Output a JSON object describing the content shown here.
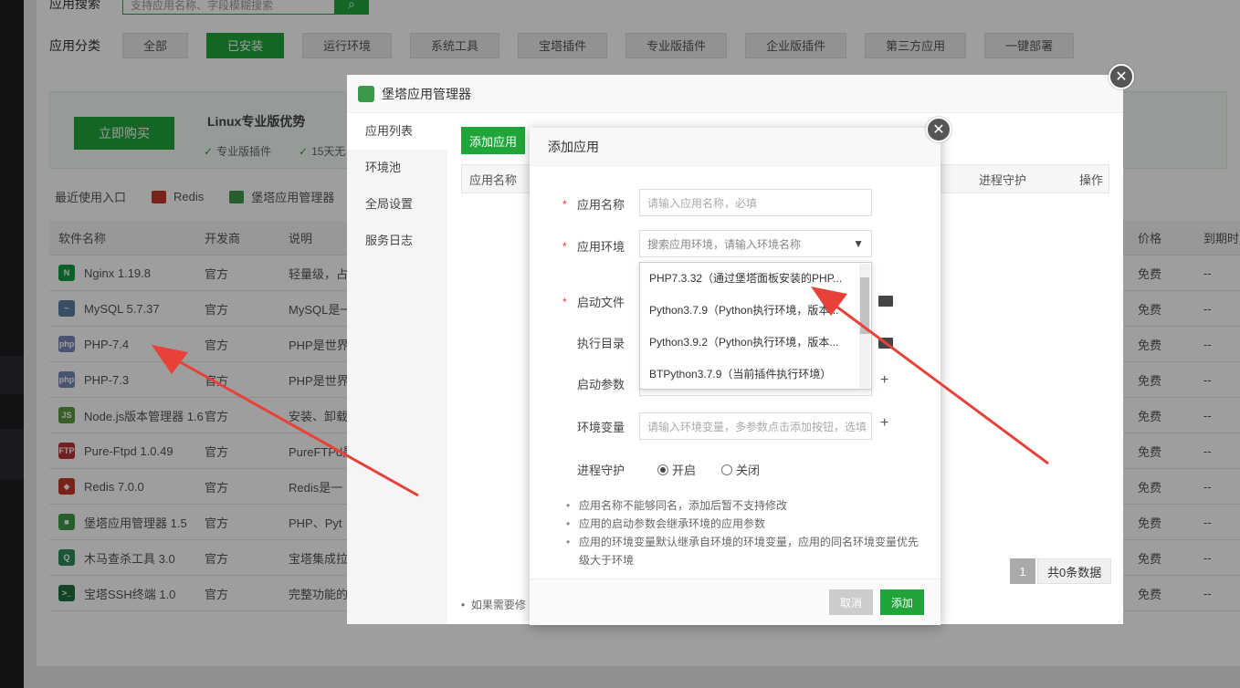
{
  "search": {
    "label": "应用搜索",
    "placeholder": "支持应用名称、字段模糊搜索"
  },
  "categories": {
    "label": "应用分类",
    "items": [
      "全部",
      "已安装",
      "运行环境",
      "系统工具",
      "宝塔插件",
      "专业版插件",
      "企业版插件",
      "第三方应用",
      "一键部署"
    ],
    "active": "已安装"
  },
  "promo": {
    "buy": "立即购买",
    "title": "Linux专业版优势",
    "feature1": "专业版插件",
    "feature2": "15天无"
  },
  "recent": {
    "label": "最近使用入口",
    "items": [
      "Redis",
      "堡塔应用管理器"
    ]
  },
  "soft_table": {
    "headers": [
      "软件名称",
      "开发商",
      "说明",
      "价格",
      "到期时间"
    ],
    "rows": [
      {
        "name": "Nginx 1.19.8",
        "dev": "官方",
        "desc": "轻量级，占",
        "price": "免费",
        "exp": "--",
        "icon": "nginx-icon",
        "color": "#119a45",
        "glyph": "N"
      },
      {
        "name": "MySQL 5.7.37",
        "dev": "官方",
        "desc": "MySQL是一",
        "price": "免费",
        "exp": "--",
        "icon": "mysql-icon",
        "color": "#5a7fa0",
        "glyph": "~"
      },
      {
        "name": "PHP-7.4",
        "dev": "官方",
        "desc": "PHP是世界",
        "price": "免费",
        "exp": "--",
        "icon": "php-icon",
        "color": "#7a86b8",
        "glyph": "php"
      },
      {
        "name": "PHP-7.3",
        "dev": "官方",
        "desc": "PHP是世界",
        "price": "免费",
        "exp": "--",
        "icon": "php-icon",
        "color": "#7a86b8",
        "glyph": "php"
      },
      {
        "name": "Node.js版本管理器 1.6",
        "dev": "官方",
        "desc": "安装、卸载",
        "price": "免费",
        "exp": "--",
        "icon": "nodejs-icon",
        "color": "#5b9a3c",
        "glyph": "JS"
      },
      {
        "name": "Pure-Ftpd 1.0.49",
        "dev": "官方",
        "desc": "PureFTPd是",
        "price": "免费",
        "exp": "--",
        "icon": "ftp-icon",
        "color": "#b33",
        "glyph": "FTP"
      },
      {
        "name": "Redis 7.0.0",
        "dev": "官方",
        "desc": "Redis是一",
        "price": "免费",
        "exp": "--",
        "icon": "redis-icon",
        "color": "#c0392b",
        "glyph": "◆"
      },
      {
        "name": "堡塔应用管理器 1.5",
        "dev": "官方",
        "desc": "PHP、Pyt",
        "price": "免费",
        "exp": "--",
        "icon": "app-manager-icon",
        "color": "#3a9a4a",
        "glyph": "■"
      },
      {
        "name": "木马查杀工具 3.0",
        "dev": "官方",
        "desc": "宝塔集成拉",
        "price": "免费",
        "exp": "--",
        "icon": "trojan-scan-icon",
        "color": "#2e8b57",
        "glyph": "Q"
      },
      {
        "name": "宝塔SSH终端 1.0",
        "dev": "官方",
        "desc": "完整功能的",
        "price": "免费",
        "exp": "--",
        "icon": "ssh-terminal-icon",
        "color": "#1f6f3a",
        "glyph": ">_"
      }
    ]
  },
  "manager": {
    "title": "堡塔应用管理器",
    "menu": [
      "应用列表",
      "环境池",
      "全局设置",
      "服务日志"
    ],
    "add_button": "添加应用",
    "columns": [
      "应用名称",
      "进程守护",
      "操作"
    ],
    "page": "1",
    "total": "共0条数据",
    "note": "如果需要修"
  },
  "dialog": {
    "title": "添加应用",
    "name_label": "应用名称",
    "name_placeholder": "请输入应用名称，必填",
    "env_label": "应用环境",
    "env_placeholder": "搜索应用环境，请输入环境名称",
    "env_options": [
      "PHP7.3.32（通过堡塔面板安装的PHP...",
      "Python3.7.9（Python执行环境，版本...",
      "Python3.9.2（Python执行环境，版本...",
      "BTPython3.7.9（当前插件执行环境）"
    ],
    "start_file_label": "启动文件",
    "exec_dir_label": "执行目录",
    "start_args_label": "启动参数",
    "env_var_label": "环境变量",
    "env_var_placeholder": "请输入环境变量，多参数点击添加按钮，选填",
    "daemon_label": "进程守护",
    "daemon_on": "开启",
    "daemon_off": "关闭",
    "notes": [
      "应用名称不能够同名，添加后暂不支持修改",
      "应用的启动参数会继承环境的应用参数",
      "应用的环境变量默认继承自环境的环境变量，应用的同名环境变量优先级大于环境"
    ],
    "cancel": "取消",
    "submit": "添加"
  },
  "colors": {
    "accent": "#20a53a",
    "annotation_arrow": "#e8413a"
  }
}
